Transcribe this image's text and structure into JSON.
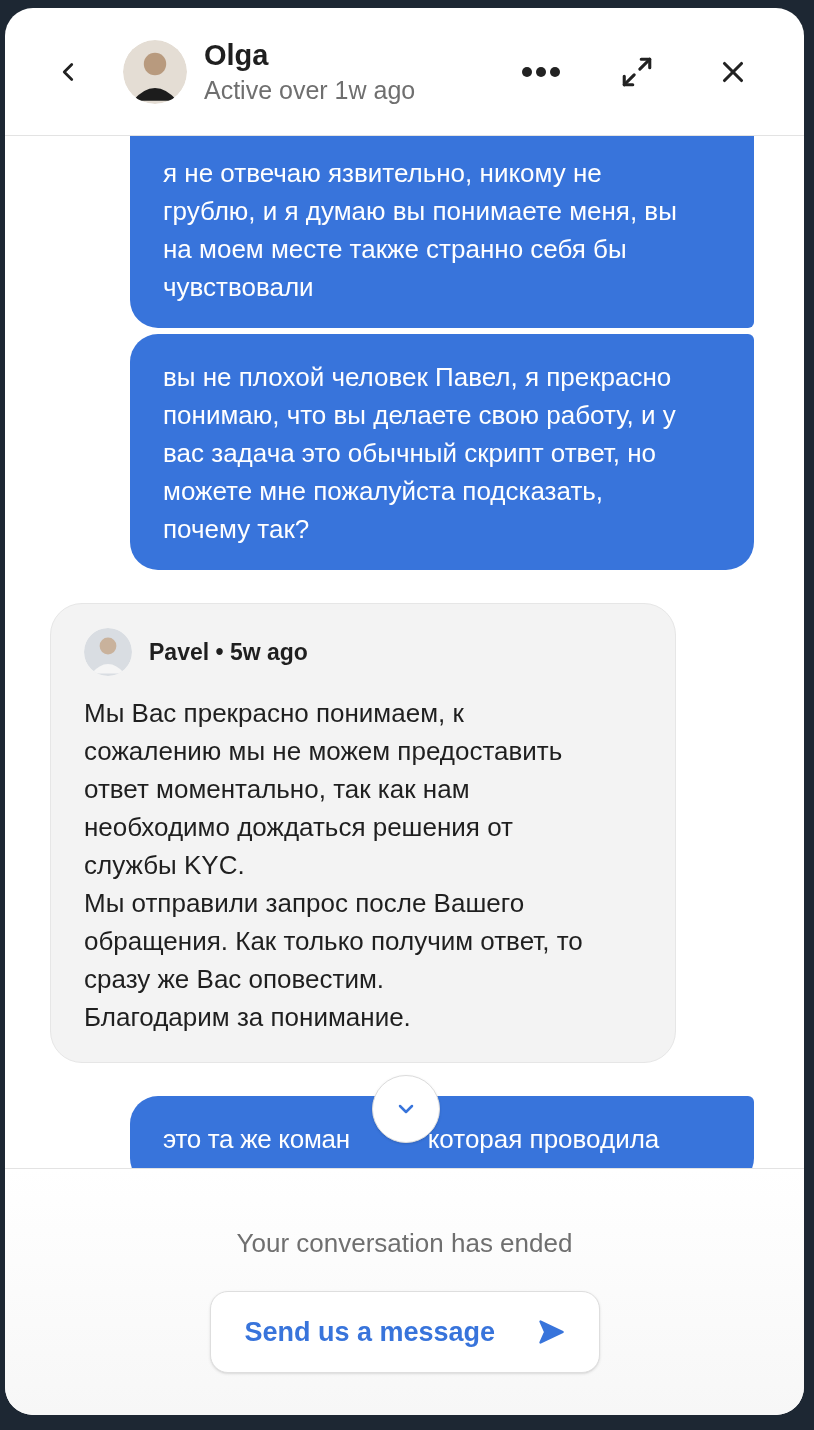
{
  "header": {
    "name": "Olga",
    "status": "Active over 1w ago"
  },
  "messages": [
    {
      "kind": "outgoing",
      "cut_top": true,
      "text": "я не отвечаю язвительно, никому не грублю, и я думаю вы понимаете меня, вы на моем месте также странно себя бы чувствовали"
    },
    {
      "kind": "outgoing",
      "cut_top": false,
      "text": "вы не плохой человек Павел, я прекрасно понимаю, что вы делаете свою работу, и у вас задача это обычный скрипт ответ, но можете мне пожалуйста подсказать, почему так?"
    },
    {
      "kind": "incoming",
      "author": "Pavel",
      "separator": "•",
      "time": "5w ago",
      "paragraphs": [
        "Мы Вас прекрасно понимаем, к сожалению мы не можем предоставить ответ моментально, так как нам необходимо дождаться решения от службы KYC.",
        "Мы отправили запрос после Вашего обращения. Как только получим ответ, то сразу же Вас оповестим.",
        "Благодарим за понимание."
      ]
    },
    {
      "kind": "outgoing",
      "cut_top": false,
      "parts": [
        "это та же коман",
        "которая проводила"
      ]
    }
  ],
  "footer": {
    "notice": "Your conversation has ended",
    "button": "Send us a message"
  }
}
